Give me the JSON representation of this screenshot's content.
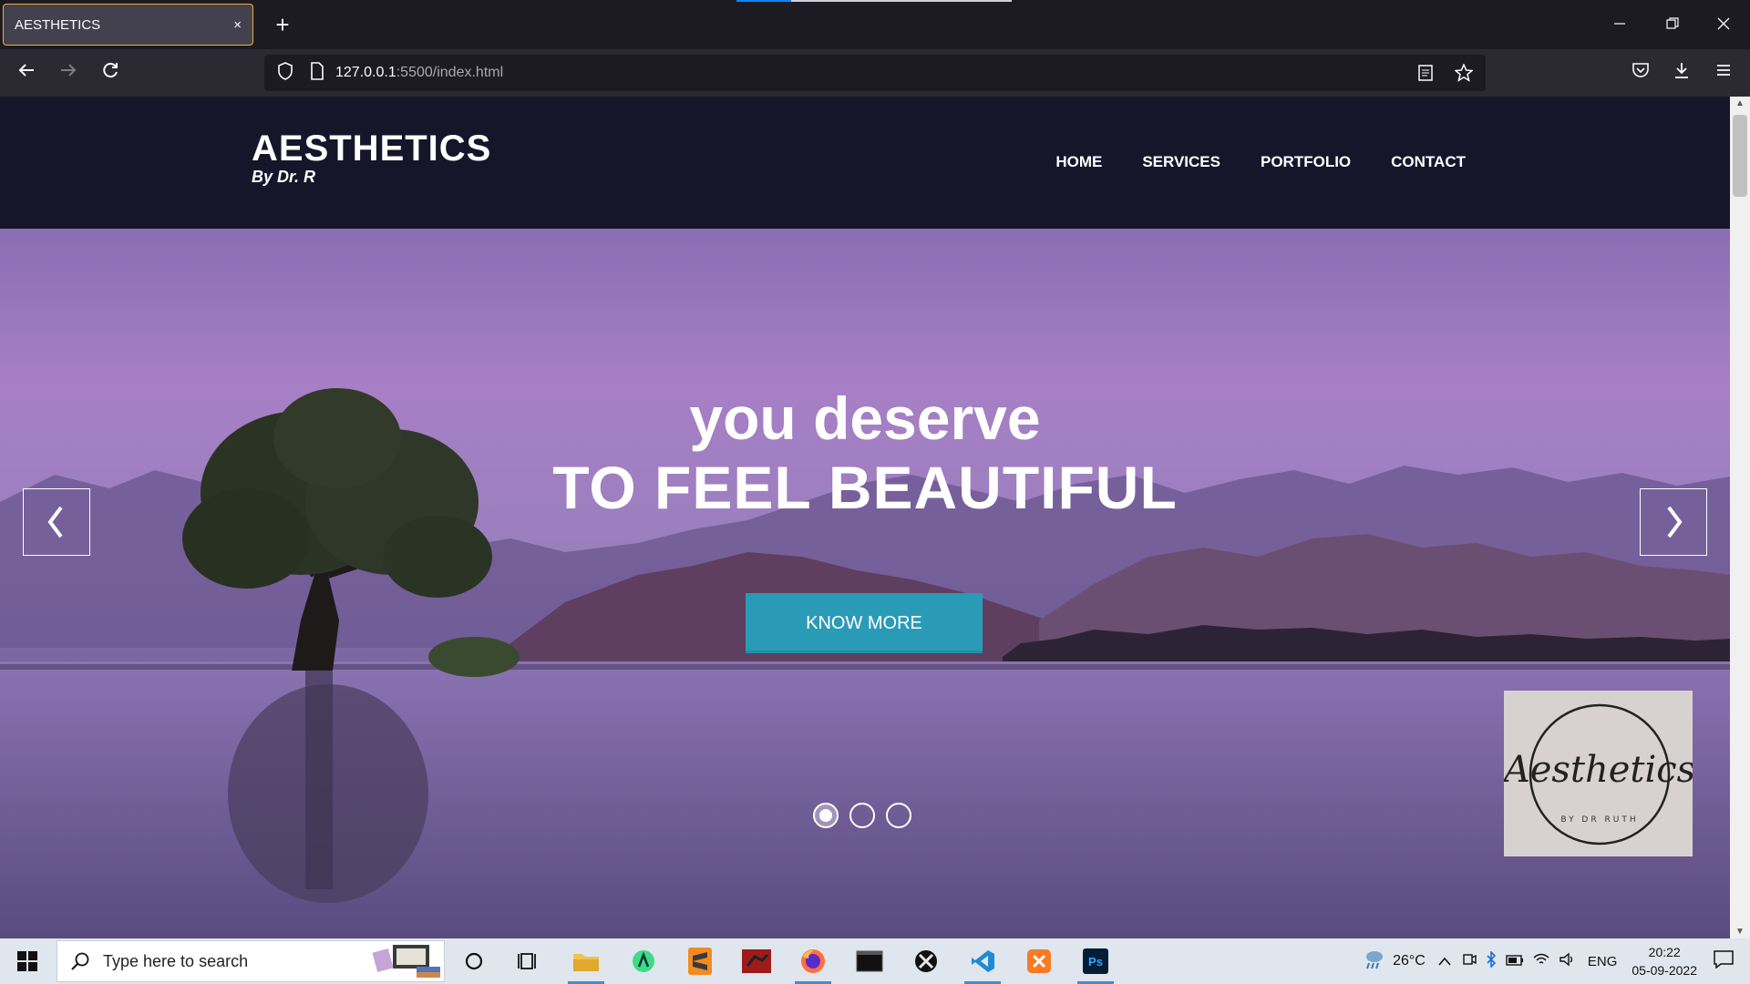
{
  "browser": {
    "tab_title": "AESTHETICS",
    "tab_close": "×",
    "new_tab": "+",
    "url_host": "127.0.0.1",
    "url_rest": ":5500/index.html"
  },
  "site": {
    "brand_name": "AESTHETICS",
    "brand_sub": "By Dr. R",
    "menu": [
      "HOME",
      "SERVICES",
      "PORTFOLIO",
      "CONTACT"
    ],
    "hero_line1": "you deserve",
    "hero_line2": "TO FEEL BEAUTIFUL",
    "cta_label": "KNOW MORE",
    "prev_arrow": "‹",
    "next_arrow": "›",
    "slides_total": 3,
    "slide_active": 1,
    "logo_text": "Aesthetics",
    "logo_sub": "BY DR RUTH"
  },
  "taskbar": {
    "search_placeholder": "Type here to search",
    "temperature": "26°C",
    "language": "ENG",
    "time": "20:22",
    "date": "05-09-2022"
  },
  "colors": {
    "accent_tab": "#f0ae42",
    "cta": "#2a9bb7",
    "header_bg": "#17152a"
  }
}
